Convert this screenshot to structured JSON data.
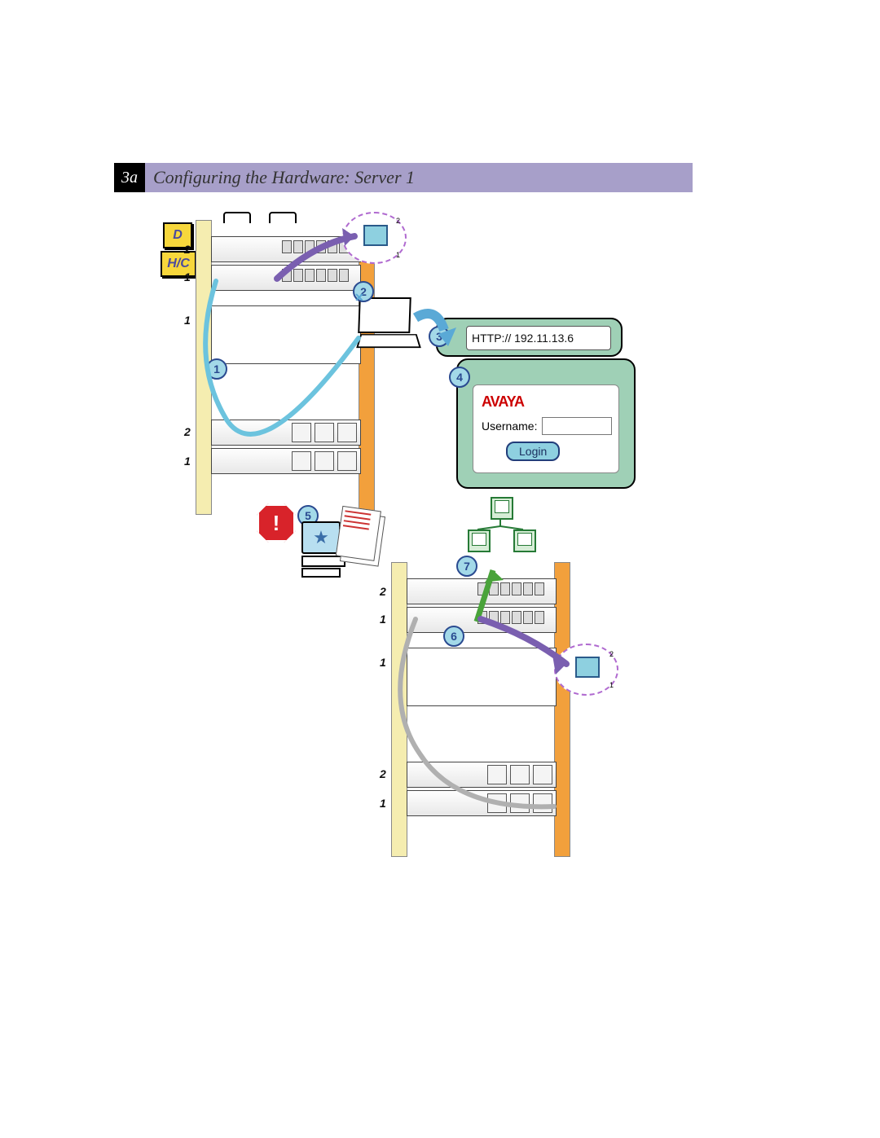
{
  "header": {
    "step_number": "3a",
    "title": "Configuring the Hardware:  Server 1"
  },
  "tags": {
    "d": "D",
    "hc": "H/C"
  },
  "steps": {
    "s1": "1",
    "s2": "2",
    "s3": "3",
    "s4": "4",
    "s5": "5",
    "s6": "6",
    "s7": "7"
  },
  "rack1_units": {
    "top2": "2",
    "top1": "1",
    "mid1": "1",
    "bot2": "2",
    "bot1": "1"
  },
  "rack2_units": {
    "top2": "2",
    "top1": "1",
    "mid1": "1",
    "bot2": "2",
    "bot1": "1"
  },
  "browser": {
    "url": "HTTP:// 192.11.13.6"
  },
  "login": {
    "brand": "AVAYA",
    "username_label": "Username:",
    "button": "Login"
  },
  "stop": {
    "mark": "!"
  },
  "zoom": {
    "t1": "1",
    "t2": "2",
    "b1": "1",
    "b2": "2"
  }
}
